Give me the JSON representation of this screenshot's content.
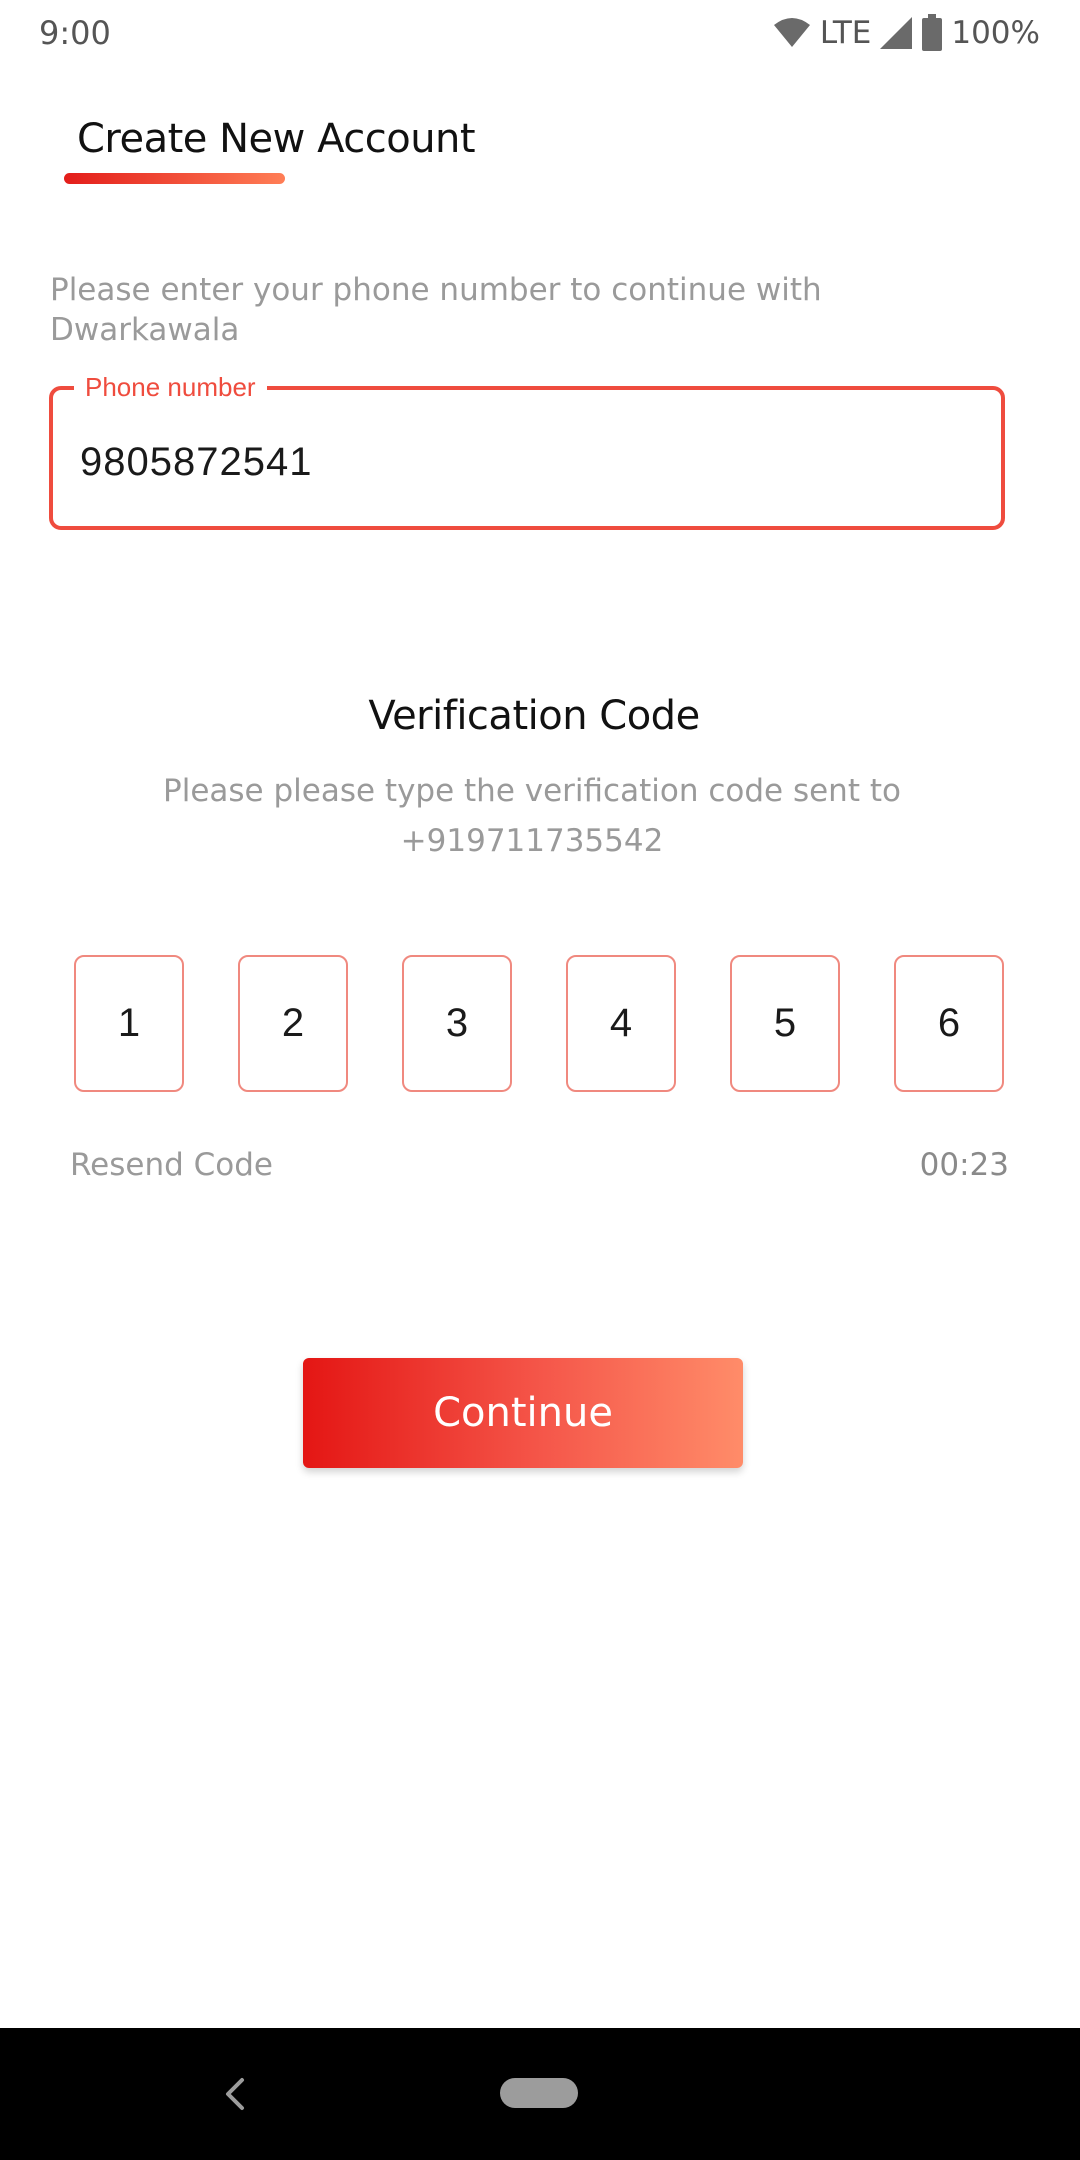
{
  "status_bar": {
    "time": "9:00",
    "network": "LTE",
    "battery": "100%",
    "icons": [
      "wifi-icon",
      "signal-icon",
      "battery-icon"
    ]
  },
  "header": {
    "title": "Create New Account"
  },
  "intro": {
    "text": "Please enter your phone number to continue with Dwarkawala"
  },
  "phone_field": {
    "label": "Phone number",
    "value": "9805872541"
  },
  "verification": {
    "title": "Verification Code",
    "subtitle_line1": "Please please type the verification code sent to",
    "subtitle_line2": "+919711735542",
    "digits": [
      "1",
      "2",
      "3",
      "4",
      "5",
      "6"
    ],
    "resend_label": "Resend Code",
    "timer": "00:23"
  },
  "actions": {
    "continue_label": "Continue"
  },
  "nav_bar": {
    "icons": [
      "back-icon",
      "home-pill-icon"
    ]
  },
  "colors": {
    "accent": "#ef4c3e",
    "gradient_start": "#e41614",
    "gradient_end": "#ff8c69",
    "muted_text": "#9a9a9a"
  }
}
